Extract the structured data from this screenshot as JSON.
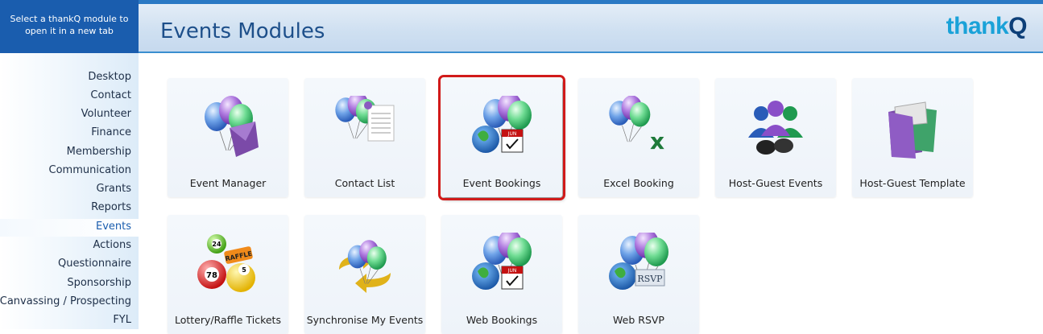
{
  "hint": {
    "text": "Select a thankQ module to open it in a new tab"
  },
  "header": {
    "title": "Events Modules",
    "logo_text": "thank",
    "logo_q": "Q"
  },
  "sidebar": {
    "items": [
      {
        "label": "Desktop"
      },
      {
        "label": "Contact"
      },
      {
        "label": "Volunteer"
      },
      {
        "label": "Finance"
      },
      {
        "label": "Membership"
      },
      {
        "label": "Communication"
      },
      {
        "label": "Grants"
      },
      {
        "label": "Reports"
      },
      {
        "label": "Events",
        "active": true
      },
      {
        "label": "Actions"
      },
      {
        "label": "Questionnaire"
      },
      {
        "label": "Sponsorship"
      },
      {
        "label": "Canvassing / Prospecting"
      },
      {
        "label": "FYL"
      }
    ]
  },
  "tiles": [
    {
      "label": "Event Manager",
      "icon": "balloons-envelope-icon"
    },
    {
      "label": "Contact List",
      "icon": "balloons-list-icon"
    },
    {
      "label": "Event Bookings",
      "icon": "balloons-calendar-icon",
      "selected": true,
      "calendar_month": "JUN"
    },
    {
      "label": "Excel Booking",
      "icon": "balloons-excel-icon"
    },
    {
      "label": "Host-Guest Events",
      "icon": "people-binoculars-icon"
    },
    {
      "label": "Host-Guest Template",
      "icon": "folder-template-icon"
    },
    {
      "label": "Lottery/Raffle Tickets",
      "icon": "lottery-balls-icon",
      "raffle_text": "RAFFLE",
      "ball_numbers": [
        "24",
        "78",
        "5"
      ]
    },
    {
      "label": "Synchronise My Events",
      "icon": "balloons-sync-icon"
    },
    {
      "label": "Web Bookings",
      "icon": "balloons-calendar-icon",
      "calendar_month": "JUN"
    },
    {
      "label": "Web RSVP",
      "icon": "balloons-rsvp-icon",
      "rsvp_text": "RSVP"
    }
  ],
  "colors": {
    "accent": "#1a5dae",
    "selection": "#d11a1a",
    "logo": "#1aa2d8"
  }
}
